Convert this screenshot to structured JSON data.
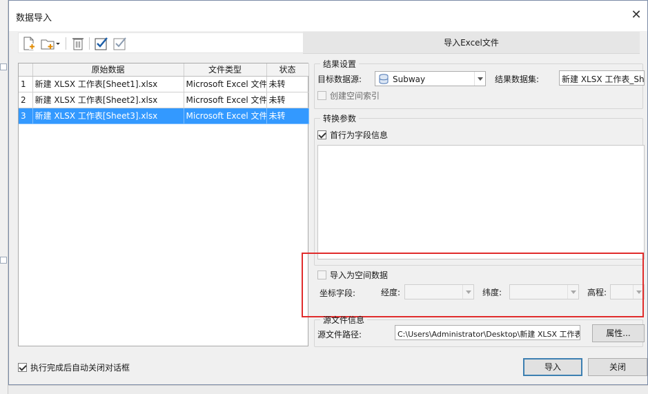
{
  "dialog": {
    "title": "数据导入",
    "close_glyph": "✕"
  },
  "toolbar": {
    "buttons": [
      "add-file-icon",
      "add-folder-icon",
      "delete-icon",
      "select-all-icon",
      "select-none-icon"
    ]
  },
  "grid": {
    "headers": [
      "原始数据",
      "文件类型",
      "状态"
    ],
    "rows": [
      {
        "index": "1",
        "source": "新建 XLSX 工作表[Sheet1].xlsx",
        "type": "Microsoft Excel 文件",
        "status": "未转"
      },
      {
        "index": "2",
        "source": "新建 XLSX 工作表[Sheet2].xlsx",
        "type": "Microsoft Excel 文件",
        "status": "未转"
      },
      {
        "index": "3",
        "source": "新建 XLSX 工作表[Sheet3].xlsx",
        "type": "Microsoft Excel 文件",
        "status": "未转"
      }
    ],
    "selected_row": 3
  },
  "auto_close": {
    "label": "执行完成后自动关闭对话框",
    "checked": true
  },
  "right": {
    "header": "导入Excel文件",
    "result": {
      "group_label": "结果设置",
      "target_ds_label": "目标数据源:",
      "target_ds_value": "Subway",
      "result_ds_label": "结果数据集:",
      "result_ds_value": "新建 XLSX 工作表_Shee",
      "spatial_index_label": "创建空间索引",
      "spatial_index_checked": false
    },
    "convert": {
      "group_label": "转换参数",
      "first_row_label": "首行为字段信息",
      "first_row_checked": true
    },
    "spatial": {
      "import_label": "导入为空间数据",
      "import_checked": false,
      "coord_label": "坐标字段:",
      "lon_label": "经度:",
      "lat_label": "纬度:",
      "elev_label": "高程:"
    },
    "source": {
      "group_label": "源文件信息",
      "path_label": "源文件路径:",
      "path_value": "C:\\Users\\Administrator\\Desktop\\新建 XLSX 工作表.x",
      "properties_button": "属性..."
    },
    "import_button": "导入",
    "close_button": "关闭"
  },
  "colors": {
    "selection": "#3399ff",
    "highlight_box": "#e02b2b",
    "default_button_border": "#3c7fb1"
  }
}
